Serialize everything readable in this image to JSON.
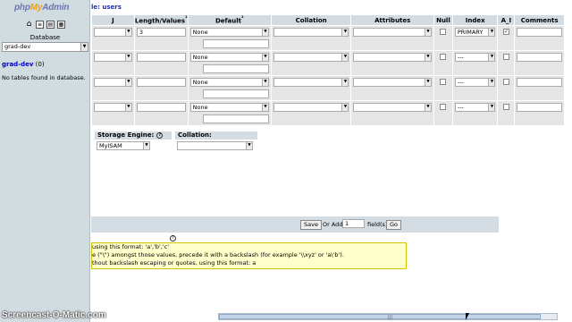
{
  "nav": {
    "logo_php": "php",
    "logo_my": "My",
    "logo_admin": "Admin",
    "database_label": "Database",
    "database_selected": "grad-dev",
    "db_name": "grad-dev",
    "db_count": " (0)",
    "no_tables": "No tables found in database."
  },
  "main": {
    "breadcrumb": "le: users",
    "columns": [
      "J",
      "Length/Values",
      "Default",
      "Collation",
      "Attributes",
      "Null",
      "Index",
      "A_I",
      "Comments"
    ],
    "rows": [
      {
        "length": "3",
        "default": "None",
        "index": "PRIMARY",
        "ai_checked": true
      },
      {
        "length": "",
        "default": "None",
        "index": "---",
        "ai_checked": false
      },
      {
        "length": "",
        "default": "None",
        "index": "---",
        "ai_checked": false
      },
      {
        "length": "",
        "default": "None",
        "index": "---",
        "ai_checked": false
      }
    ],
    "storage_engine_label": "Storage Engine:",
    "storage_engine_value": "MyISAM",
    "collation_label": "Collation:",
    "save_label": "Save",
    "or_add_label": "Or Add",
    "add_count": "1",
    "fields_label": "field(s)",
    "go_label": "Go",
    "info_lines": [
      "using this format: 'a','b','c'",
      "e (\"\\\") amongst those values, precede it with a backslash (for example '\\\\xyz' or 'a\\'b').",
      "thout backslash escaping or quotes, using this format: a"
    ]
  },
  "watermark": "Screencast-O-Matic.com",
  "colors": {
    "left_frame": "#d0dce0",
    "header_bg": "#d3dce3",
    "row_bg": "#e5e5e5",
    "info_bg": "#ffffcc"
  }
}
